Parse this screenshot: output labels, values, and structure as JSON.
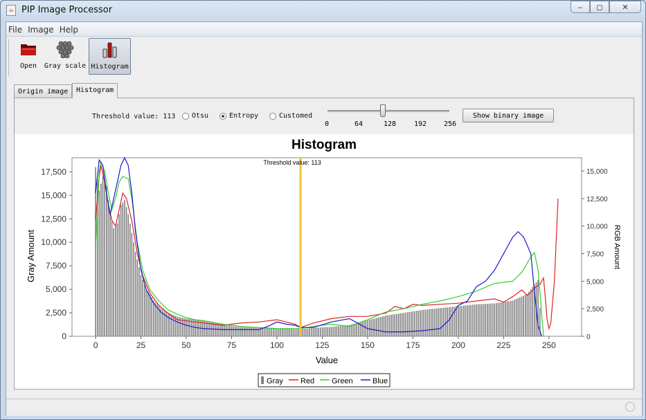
{
  "window": {
    "title": "PIP Image Processor",
    "app_icon": "java-icon",
    "btn_min": "‒",
    "btn_max": "◻",
    "btn_close": "✕"
  },
  "menu": [
    "File",
    "Image",
    "Help"
  ],
  "toolbar": {
    "open_label": "Open",
    "grayscale_label": "Gray scale",
    "histogram_label": "Histogram"
  },
  "tabs": [
    "Origin image",
    "Histogram"
  ],
  "controls": {
    "threshold_label": "Threshold value: 113",
    "radio_otsu": "Otsu",
    "radio_entropy": "Entropy",
    "radio_customed": "Customed",
    "selected": "Entropy",
    "slider_value": 113,
    "slider_min": 0,
    "slider_max": 256,
    "slider_ticks": [
      "0",
      "64",
      "128",
      "192",
      "256"
    ],
    "show_button": "Show binary image"
  },
  "colors": {
    "gray": "#808080",
    "red": "#dd2222",
    "green": "#33cc33",
    "blue": "#1a1acc",
    "threshold": "#f4c430"
  },
  "chart_data": {
    "type": "bar",
    "title": "Histogram",
    "marker_label": "Threshold value: 113",
    "threshold": 113,
    "xlabel": "Value",
    "ylabel_left": "Gray Amount",
    "ylabel_right": "RGB Amount",
    "xlim": [
      -13,
      268
    ],
    "ylim_left": [
      0,
      19000
    ],
    "ylim_right": [
      0,
      16200
    ],
    "xticks": [
      0,
      25,
      50,
      75,
      100,
      125,
      150,
      175,
      200,
      225,
      250
    ],
    "yticks_left": [
      "0",
      "2,500",
      "5,000",
      "7,500",
      "10,000",
      "12,500",
      "15,000",
      "17,500"
    ],
    "yticks_left_values": [
      0,
      2500,
      5000,
      7500,
      10000,
      12500,
      15000,
      17500
    ],
    "yticks_right": [
      "0",
      "2,500",
      "5,000",
      "7,500",
      "10,000",
      "12,500",
      "15,000"
    ],
    "yticks_right_values": [
      0,
      2500,
      5000,
      7500,
      10000,
      12500,
      15000
    ],
    "legend": [
      "Gray",
      "Red",
      "Green",
      "Blue"
    ],
    "gray_points": [
      [
        0,
        18000
      ],
      [
        2,
        15500
      ],
      [
        4,
        17000
      ],
      [
        6,
        16000
      ],
      [
        8,
        13000
      ],
      [
        10,
        11500
      ],
      [
        12,
        12000
      ],
      [
        14,
        14000
      ],
      [
        16,
        14500
      ],
      [
        18,
        13000
      ],
      [
        20,
        11000
      ],
      [
        22,
        9000
      ],
      [
        25,
        6500
      ],
      [
        28,
        5000
      ],
      [
        32,
        3800
      ],
      [
        36,
        3000
      ],
      [
        40,
        2500
      ],
      [
        45,
        2100
      ],
      [
        50,
        1900
      ],
      [
        55,
        1800
      ],
      [
        60,
        1700
      ],
      [
        65,
        1500
      ],
      [
        70,
        1300
      ],
      [
        75,
        1100
      ],
      [
        80,
        1000
      ],
      [
        90,
        900
      ],
      [
        100,
        800
      ],
      [
        110,
        750
      ],
      [
        115,
        800
      ],
      [
        120,
        900
      ],
      [
        130,
        1000
      ],
      [
        140,
        1200
      ],
      [
        150,
        1700
      ],
      [
        160,
        2200
      ],
      [
        170,
        2500
      ],
      [
        180,
        2800
      ],
      [
        190,
        3000
      ],
      [
        200,
        3200
      ],
      [
        210,
        3400
      ],
      [
        220,
        3500
      ],
      [
        230,
        3800
      ],
      [
        238,
        4500
      ],
      [
        242,
        5500
      ],
      [
        244,
        6000
      ],
      [
        245,
        3000
      ],
      [
        246,
        0
      ]
    ],
    "red_points": [
      [
        0,
        10500
      ],
      [
        2,
        14500
      ],
      [
        3,
        15500
      ],
      [
        5,
        14000
      ],
      [
        7,
        12000
      ],
      [
        9,
        10500
      ],
      [
        11,
        10000
      ],
      [
        13,
        11500
      ],
      [
        15,
        13000
      ],
      [
        17,
        12500
      ],
      [
        20,
        10500
      ],
      [
        23,
        7500
      ],
      [
        26,
        5500
      ],
      [
        30,
        3900
      ],
      [
        35,
        2800
      ],
      [
        40,
        2100
      ],
      [
        45,
        1500
      ],
      [
        50,
        1400
      ],
      [
        55,
        1300
      ],
      [
        60,
        1200
      ],
      [
        70,
        1000
      ],
      [
        80,
        1200
      ],
      [
        90,
        1300
      ],
      [
        100,
        1500
      ],
      [
        105,
        1300
      ],
      [
        110,
        1100
      ],
      [
        113,
        800
      ],
      [
        120,
        1200
      ],
      [
        130,
        1600
      ],
      [
        140,
        1800
      ],
      [
        150,
        1800
      ],
      [
        160,
        2100
      ],
      [
        165,
        2700
      ],
      [
        170,
        2500
      ],
      [
        175,
        2900
      ],
      [
        180,
        2800
      ],
      [
        190,
        2900
      ],
      [
        200,
        3000
      ],
      [
        210,
        3200
      ],
      [
        220,
        3400
      ],
      [
        225,
        3100
      ],
      [
        230,
        3600
      ],
      [
        235,
        4200
      ],
      [
        238,
        3700
      ],
      [
        240,
        4000
      ],
      [
        243,
        4500
      ],
      [
        245,
        4700
      ],
      [
        247,
        5300
      ],
      [
        248,
        3500
      ],
      [
        249,
        1500
      ],
      [
        250,
        700
      ],
      [
        251,
        1200
      ],
      [
        253,
        5000
      ],
      [
        255,
        12500
      ]
    ],
    "green_points": [
      [
        0,
        8000
      ],
      [
        2,
        15000
      ],
      [
        3,
        15800
      ],
      [
        5,
        15000
      ],
      [
        7,
        13000
      ],
      [
        9,
        11500
      ],
      [
        11,
        12500
      ],
      [
        13,
        14000
      ],
      [
        15,
        14500
      ],
      [
        18,
        14300
      ],
      [
        20,
        12500
      ],
      [
        23,
        8500
      ],
      [
        26,
        6000
      ],
      [
        30,
        4200
      ],
      [
        35,
        3200
      ],
      [
        40,
        2400
      ],
      [
        45,
        2000
      ],
      [
        50,
        1700
      ],
      [
        55,
        1500
      ],
      [
        60,
        1400
      ],
      [
        70,
        1100
      ],
      [
        80,
        900
      ],
      [
        90,
        800
      ],
      [
        100,
        700
      ],
      [
        110,
        700
      ],
      [
        113,
        700
      ],
      [
        120,
        900
      ],
      [
        130,
        1100
      ],
      [
        140,
        900
      ],
      [
        150,
        1500
      ],
      [
        160,
        2200
      ],
      [
        170,
        2500
      ],
      [
        180,
        2900
      ],
      [
        190,
        3200
      ],
      [
        200,
        3600
      ],
      [
        210,
        4100
      ],
      [
        220,
        4800
      ],
      [
        230,
        5000
      ],
      [
        235,
        5800
      ],
      [
        240,
        7200
      ],
      [
        242,
        7600
      ],
      [
        244,
        6000
      ],
      [
        246,
        2000
      ],
      [
        247,
        0
      ]
    ],
    "blue_points": [
      [
        0,
        13000
      ],
      [
        2,
        16000
      ],
      [
        4,
        15500
      ],
      [
        6,
        13000
      ],
      [
        8,
        11000
      ],
      [
        10,
        12500
      ],
      [
        12,
        14000
      ],
      [
        14,
        15500
      ],
      [
        16,
        16200
      ],
      [
        18,
        15500
      ],
      [
        20,
        13000
      ],
      [
        22,
        9500
      ],
      [
        25,
        6000
      ],
      [
        28,
        4200
      ],
      [
        32,
        3000
      ],
      [
        36,
        2200
      ],
      [
        40,
        1700
      ],
      [
        45,
        1300
      ],
      [
        50,
        1000
      ],
      [
        55,
        800
      ],
      [
        60,
        700
      ],
      [
        70,
        600
      ],
      [
        80,
        600
      ],
      [
        90,
        600
      ],
      [
        95,
        900
      ],
      [
        100,
        1300
      ],
      [
        105,
        1100
      ],
      [
        110,
        1000
      ],
      [
        113,
        800
      ],
      [
        120,
        800
      ],
      [
        130,
        1300
      ],
      [
        140,
        1600
      ],
      [
        150,
        700
      ],
      [
        160,
        400
      ],
      [
        170,
        400
      ],
      [
        180,
        500
      ],
      [
        190,
        700
      ],
      [
        195,
        1500
      ],
      [
        200,
        2800
      ],
      [
        205,
        3200
      ],
      [
        210,
        4500
      ],
      [
        215,
        5000
      ],
      [
        220,
        6000
      ],
      [
        225,
        7500
      ],
      [
        230,
        9000
      ],
      [
        233,
        9500
      ],
      [
        236,
        9000
      ],
      [
        240,
        7500
      ],
      [
        242,
        4000
      ],
      [
        244,
        1000
      ],
      [
        246,
        0
      ]
    ]
  }
}
